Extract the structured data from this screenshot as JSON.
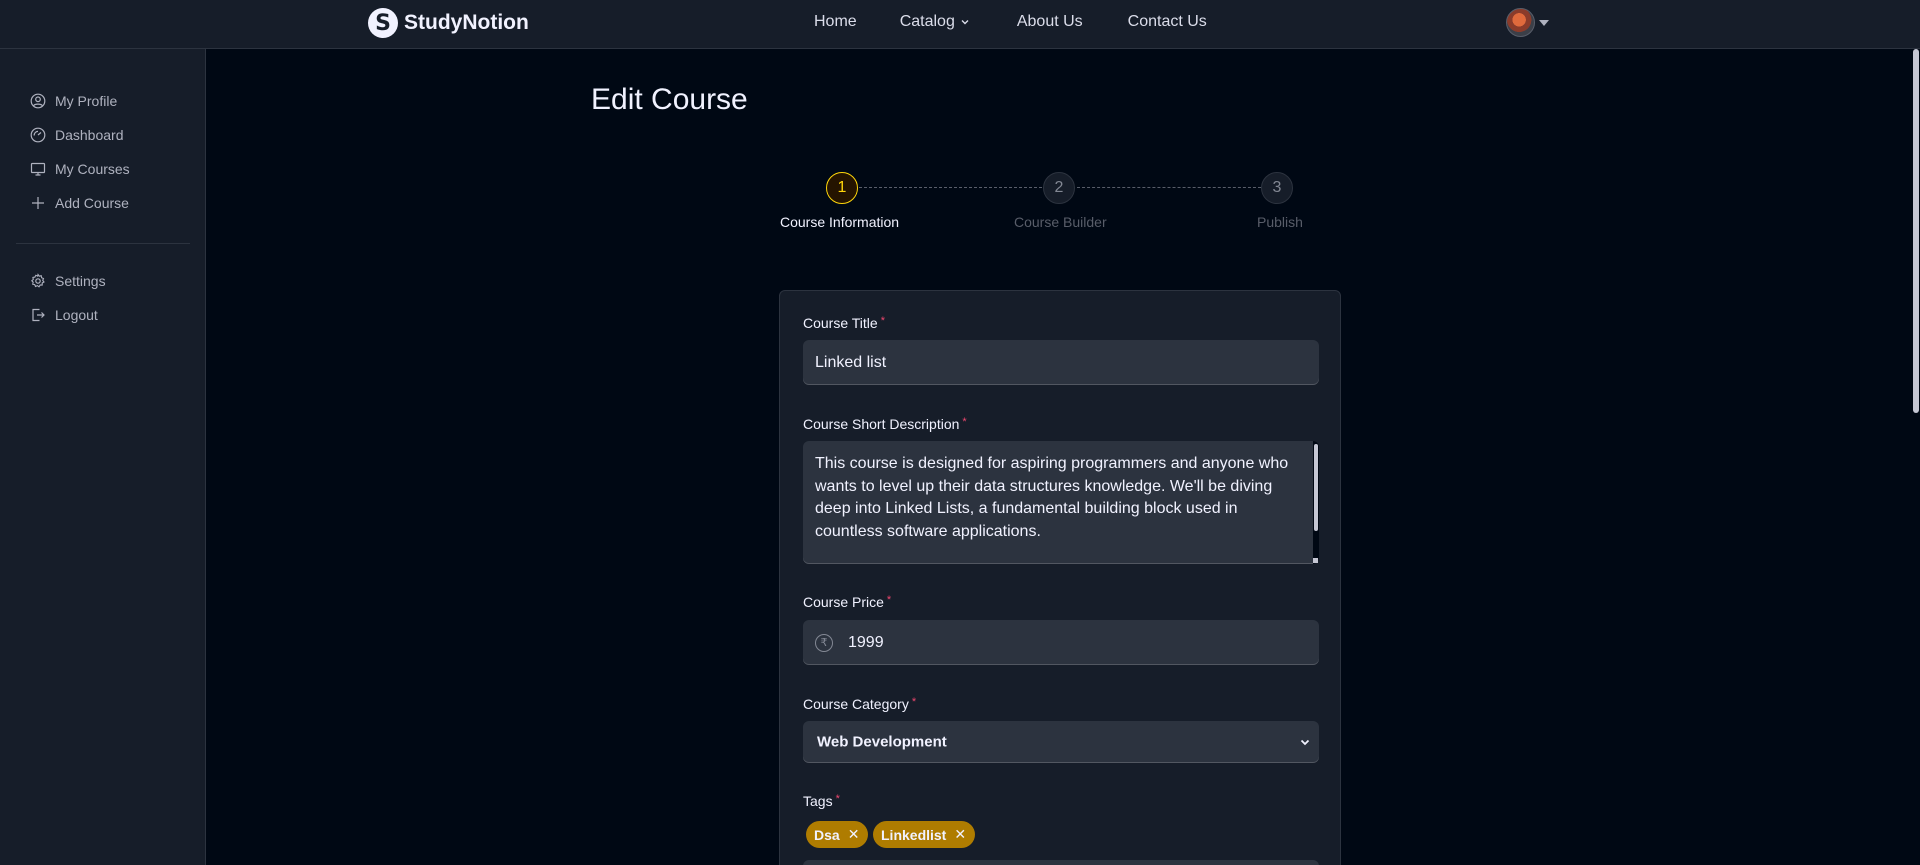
{
  "brand": {
    "name": "StudyNotion",
    "logo_letter": "S"
  },
  "nav": {
    "home": "Home",
    "catalog": "Catalog",
    "about": "About Us",
    "contact": "Contact Us",
    "catalog_icon": "chevron-down-icon",
    "profile_icon": "caret-down-icon"
  },
  "sidebar": {
    "items": [
      {
        "label": "My Profile",
        "icon": "user-circle-icon"
      },
      {
        "label": "Dashboard",
        "icon": "dashboard-gauge-icon"
      },
      {
        "label": "My Courses",
        "icon": "monitor-icon"
      },
      {
        "label": "Add Course",
        "icon": "plus-icon"
      }
    ],
    "bottom_items": [
      {
        "label": "Settings",
        "icon": "gear-icon"
      },
      {
        "label": "Logout",
        "icon": "logout-icon"
      }
    ]
  },
  "page": {
    "title": "Edit Course"
  },
  "stepper": {
    "steps": [
      {
        "number": "1",
        "label": "Course Information",
        "state": "active"
      },
      {
        "number": "2",
        "label": "Course Builder",
        "state": "inactive"
      },
      {
        "number": "3",
        "label": "Publish",
        "state": "inactive"
      }
    ]
  },
  "form": {
    "title_label": "Course Title",
    "title_value": "Linked list",
    "desc_label": "Course Short Description",
    "desc_value": "This course is designed for aspiring programmers and anyone who wants to level up their data structures knowledge. We'll be diving deep into Linked Lists, a fundamental building block used in countless software applications.",
    "price_label": "Course Price",
    "price_value": "1999",
    "currency_symbol": "₹",
    "category_label": "Course Category",
    "category_value": "Web Development",
    "tags_label": "Tags",
    "tags": [
      "Dsa",
      "Linkedlist"
    ],
    "required_mark": "*"
  },
  "colors": {
    "background": "#000814",
    "panel": "#161D29",
    "input": "#2C333F",
    "accent_yellow": "#FFD60A",
    "tag": "#AF7C00",
    "required": "#EF476F"
  }
}
